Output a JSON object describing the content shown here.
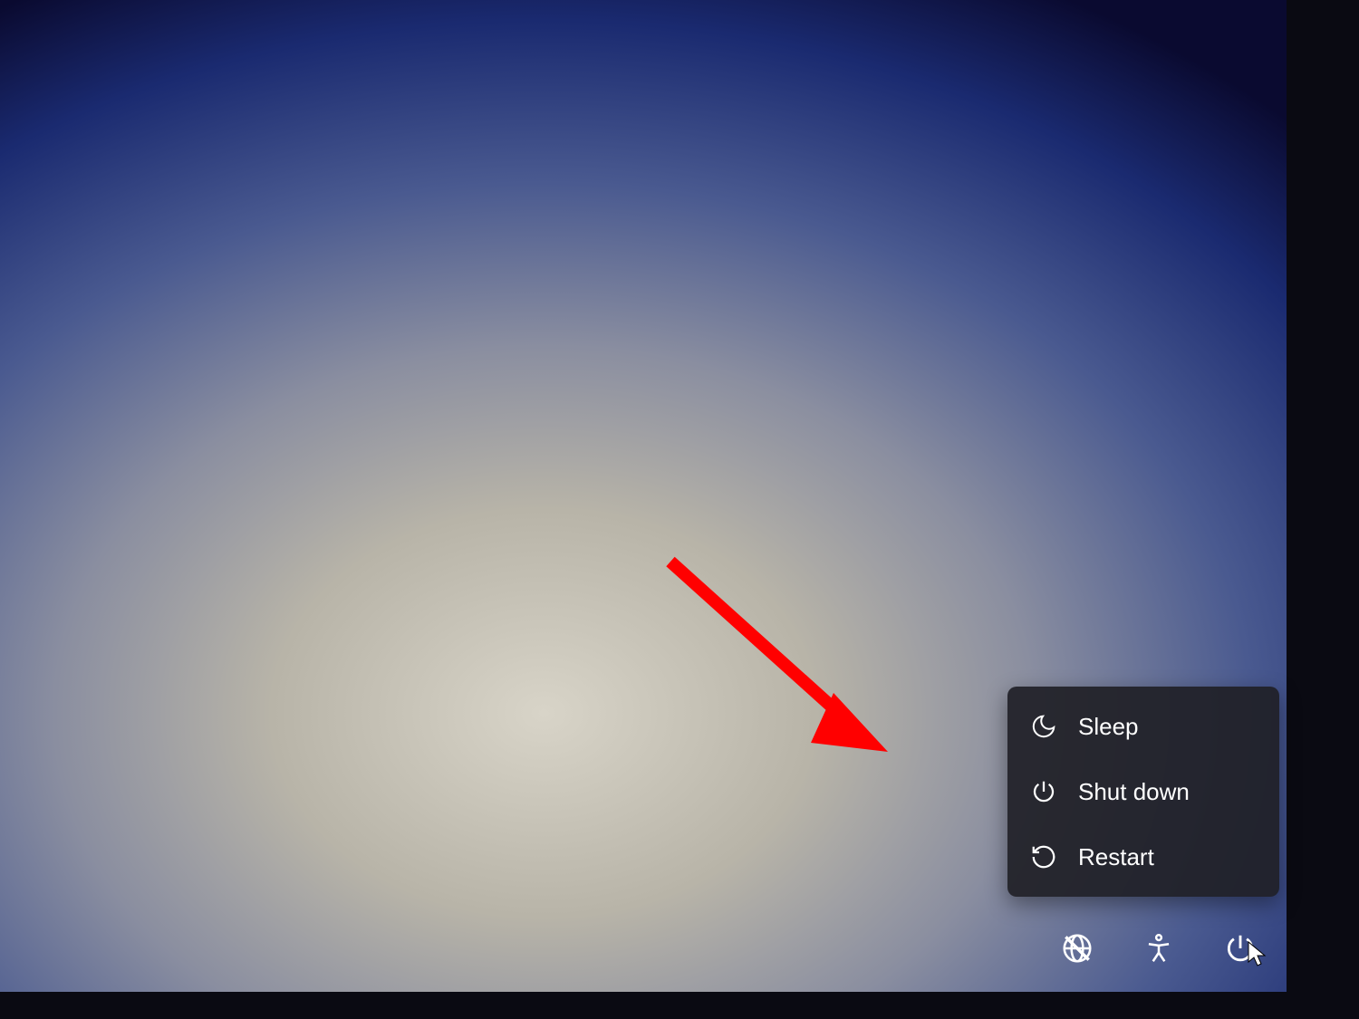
{
  "power_menu": {
    "items": [
      {
        "label": "Sleep",
        "icon": "moon-icon"
      },
      {
        "label": "Shut down",
        "icon": "power-icon"
      },
      {
        "label": "Restart",
        "icon": "restart-icon"
      }
    ]
  },
  "bottom_bar": {
    "icons": [
      {
        "name": "network-icon"
      },
      {
        "name": "accessibility-icon"
      },
      {
        "name": "power-icon"
      }
    ]
  },
  "annotation": {
    "arrow_color": "#ff0000"
  }
}
